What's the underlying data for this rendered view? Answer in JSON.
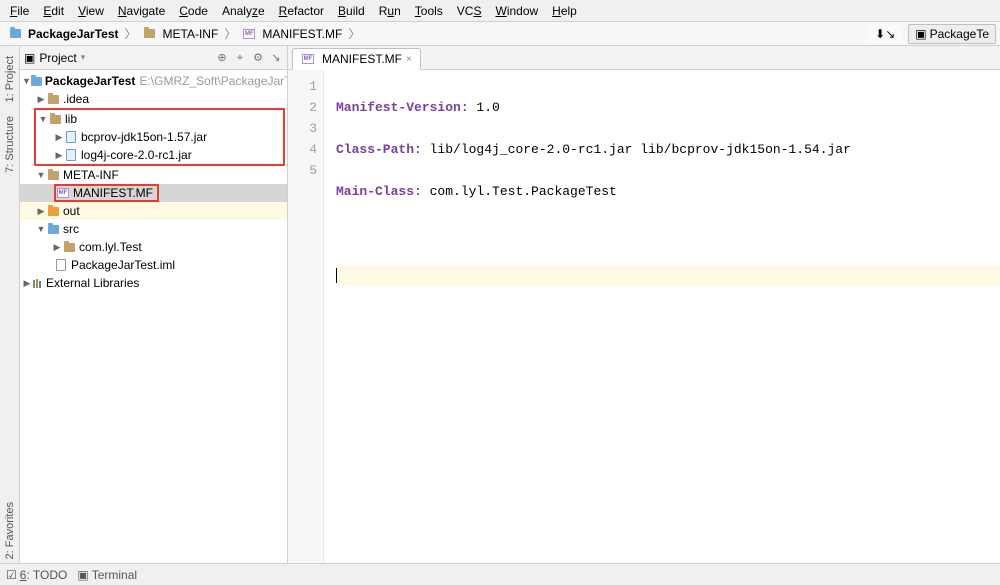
{
  "menu": [
    "File",
    "Edit",
    "View",
    "Navigate",
    "Code",
    "Analyze",
    "Refactor",
    "Build",
    "Run",
    "Tools",
    "VCS",
    "Window",
    "Help"
  ],
  "breadcrumbs": [
    {
      "label": "PackageJarTest",
      "icon": "folder-blue"
    },
    {
      "label": "META-INF",
      "icon": "folder"
    },
    {
      "label": "MANIFEST.MF",
      "icon": "mf"
    }
  ],
  "nav_right_button": "PackageTe",
  "panel": {
    "title": "Project"
  },
  "vertical_tabs": [
    "1: Project",
    "7: Structure",
    "2: Favorites"
  ],
  "tree": {
    "root": {
      "label": "PackageJarTest",
      "path": "E:\\GMRZ_Soft\\PackageJarTest"
    },
    "idea": ".idea",
    "lib": "lib",
    "lib_items": [
      "bcprov-jdk15on-1.57.jar",
      "log4j-core-2.0-rc1.jar"
    ],
    "metainf": "META-INF",
    "manifest": "MANIFEST.MF",
    "out": "out",
    "src": "src",
    "src_pkg": "com.lyl.Test",
    "iml": "PackageJarTest.iml",
    "ext": "External Libraries"
  },
  "editor": {
    "tab": "MANIFEST.MF",
    "lines": [
      {
        "k": "Manifest-Version:",
        "v": " 1.0"
      },
      {
        "k": "Class-Path:",
        "v": " lib/log4j_core-2.0-rc1.jar lib/bcprov-jdk15on-1.54.jar"
      },
      {
        "k": "Main-Class:",
        "v": " com.lyl.Test.PackageTest"
      },
      {
        "k": "",
        "v": ""
      },
      {
        "k": "",
        "v": ""
      }
    ],
    "gutter": [
      1,
      2,
      3,
      4,
      5
    ]
  },
  "status": {
    "todo": "6: TODO",
    "terminal": "Terminal"
  }
}
